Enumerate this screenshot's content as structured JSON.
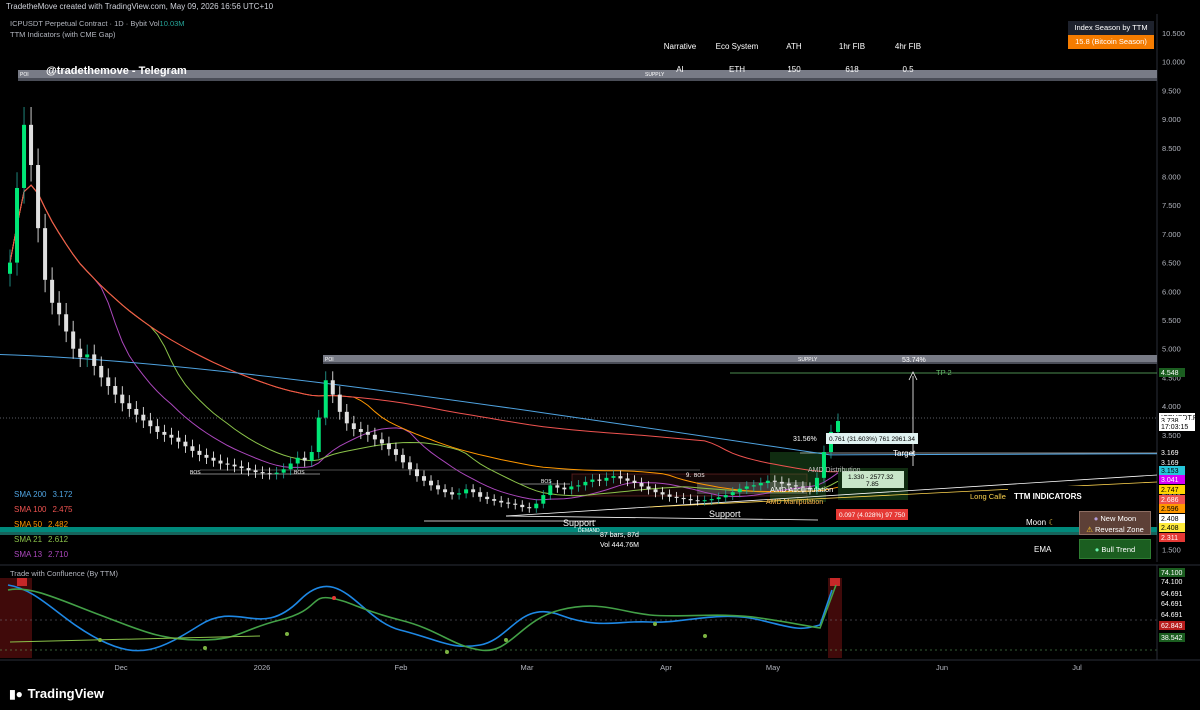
{
  "header": {
    "text": "TradetheMove created with TradingView.com, May 09, 2026 16:56 UTC+10"
  },
  "symbol": {
    "line": "ICPUSDT Perpetual Contract · 1D · Bybit",
    "vol_label": "Vol",
    "vol_value": "10.03M"
  },
  "indicator_title": "TTM Indicators (with CME Gap)",
  "watermark": "@tradethemove - Telegram",
  "info_table": {
    "headers": [
      "Narrative",
      "Eco System",
      "ATH",
      "1hr FIB",
      "4hr FIB"
    ],
    "values": [
      "AI",
      "ETH",
      "150",
      "618",
      "0.5"
    ]
  },
  "index_box": {
    "title": "Index Season by TTM",
    "value": "15.8 (Bitcoin Season)",
    "color": "#f57c00"
  },
  "sma_legend": [
    {
      "name": "SMA 200",
      "value": "3.172",
      "color": "#4fa3e0"
    },
    {
      "name": "SMA 100",
      "value": "2.475",
      "color": "#ef5350"
    },
    {
      "name": "SMA 50",
      "value": "2.482",
      "color": "#ff9800"
    },
    {
      "name": "SMA 21",
      "value": "2.612",
      "color": "#8bc34a"
    },
    {
      "name": "SMA 13",
      "value": "2.710",
      "color": "#ab47bc"
    }
  ],
  "ttm_panel": {
    "title": "TTM INDICATORS",
    "moon_label": "Moon",
    "moon_icon": "moon-icon",
    "moon_status_1": "New Moon",
    "moon_status_2": "Reversal Zone",
    "ema_label": "EMA",
    "trend": "Bull Trend"
  },
  "oscillator": {
    "title": "Trade with Confluence (By TTM)"
  },
  "footer": {
    "brand": "TradingView"
  },
  "annotations": {
    "poi_top": "POI",
    "supply_top": "SUPPLY",
    "poi_mid": "POI",
    "supply_mid": "SUPPLY",
    "tp2": "TP 2",
    "pct_tp": "53.74%",
    "target": "Target",
    "pct_move": "31.56%",
    "measure1": "0.761 (31.603%) 761 2961.34",
    "measure2_a": "1.330 - 2577.32",
    "measure2_b": "7.85",
    "measure3": "0.097 (4.028%) 97 750",
    "amd_acc": "AMD Accumulation",
    "amd_dist": "AMD Distribution",
    "amd_manip": "AMD Manipulation",
    "long_call": "Long Calle",
    "support_left": "Support",
    "support_right": "Support",
    "demand": "DEMAND",
    "bos1": "BOS",
    "bos2": "BOS",
    "bos3": "BOS",
    "bars": "87 bars, 87d",
    "vol": "Vol 444.76M",
    "fib_small": "9.",
    "bos4": "BOS"
  },
  "price_axis": [
    "10.500",
    "10.000",
    "9.500",
    "9.000",
    "8.500",
    "8.000",
    "7.500",
    "7.000",
    "6.500",
    "6.000",
    "5.500",
    "5.000",
    "4.500",
    "4.000",
    "3.500",
    "3.000",
    "2.500",
    "2.000",
    "1.500"
  ],
  "price_tags": [
    {
      "label": "4.548",
      "color": "#1b5e20"
    },
    {
      "label": "ICPUSDT.P",
      "color": "#ffffff",
      "text_color": "#000000"
    },
    {
      "label": "3.738",
      "color": "#ffffff",
      "text_color": "#000000"
    },
    {
      "label": "17:03:15",
      "color": "#ffffff",
      "text_color": "#000000"
    },
    {
      "label": "3.169",
      "color": "#000000",
      "text_color": "#ffffff"
    },
    {
      "label": "3.169",
      "color": "#000000",
      "text_color": "#ffffff"
    },
    {
      "label": "3.153",
      "color": "#26c6da",
      "text_color": "#000000"
    },
    {
      "label": "3.041",
      "color": "#d500f9",
      "text_color": "#ffffff"
    },
    {
      "label": "2.747",
      "color": "#ffd600",
      "text_color": "#000000"
    },
    {
      "label": "2.686",
      "color": "#ef5350",
      "text_color": "#ffffff"
    },
    {
      "label": "2.596",
      "color": "#ff9800",
      "text_color": "#000000"
    },
    {
      "label": "2.408",
      "color": "#ffffff",
      "text_color": "#000000"
    },
    {
      "label": "2.408",
      "color": "#ffeb3b",
      "text_color": "#000000"
    },
    {
      "label": "2.311",
      "color": "#e53935",
      "text_color": "#ffffff"
    }
  ],
  "osc_tags": [
    {
      "label": "74.100",
      "color": "#1b5e20"
    },
    {
      "label": "74.100",
      "color": "#000000"
    },
    {
      "label": "64.691",
      "color": "#000000"
    },
    {
      "label": "64.691",
      "color": "#000000"
    },
    {
      "label": "64.691",
      "color": "#000000"
    },
    {
      "label": "62.843",
      "color": "#b71c1c"
    },
    {
      "label": "38.542",
      "color": "#1b5e20"
    }
  ],
  "time_axis": [
    "Dec",
    "2026",
    "Feb",
    "Mar",
    "Apr",
    "May",
    "Jun",
    "Jul"
  ],
  "chart_data": {
    "type": "candlestick",
    "symbol": "ICPUSDT.P",
    "interval": "1D",
    "ylim": [
      1.5,
      10.5
    ],
    "grid": false,
    "current_price": 3.738,
    "close_series": [
      6.5,
      7.8,
      8.9,
      8.2,
      7.1,
      6.2,
      5.8,
      5.6,
      5.3,
      5.0,
      4.85,
      4.9,
      4.7,
      4.5,
      4.35,
      4.2,
      4.05,
      3.95,
      3.85,
      3.75,
      3.65,
      3.55,
      3.5,
      3.45,
      3.38,
      3.3,
      3.22,
      3.15,
      3.1,
      3.05,
      3.0,
      2.98,
      2.95,
      2.92,
      2.88,
      2.85,
      2.83,
      2.82,
      2.84,
      2.9,
      3.0,
      3.1,
      3.05,
      3.2,
      3.8,
      4.45,
      4.2,
      3.9,
      3.7,
      3.6,
      3.55,
      3.5,
      3.42,
      3.35,
      3.25,
      3.15,
      3.02,
      2.9,
      2.78,
      2.7,
      2.62,
      2.55,
      2.5,
      2.46,
      2.48,
      2.55,
      2.5,
      2.42,
      2.38,
      2.35,
      2.32,
      2.3,
      2.28,
      2.24,
      2.22,
      2.3,
      2.45,
      2.62,
      2.58,
      2.55,
      2.6,
      2.62,
      2.68,
      2.72,
      2.7,
      2.75,
      2.78,
      2.74,
      2.7,
      2.66,
      2.6,
      2.55,
      2.5,
      2.46,
      2.42,
      2.4,
      2.38,
      2.36,
      2.35,
      2.36,
      2.38,
      2.41,
      2.45,
      2.5,
      2.56,
      2.6,
      2.62,
      2.66,
      2.7,
      2.68,
      2.65,
      2.62,
      2.6,
      2.58,
      2.55,
      2.75,
      3.2,
      3.55,
      3.74
    ]
  }
}
